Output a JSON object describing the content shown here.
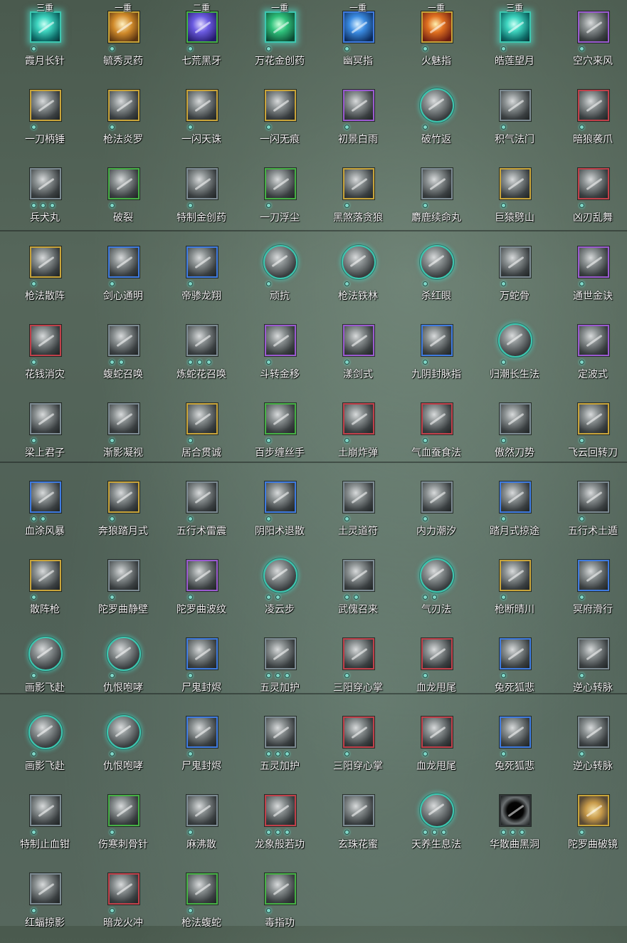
{
  "skills": [
    [
      {
        "name": "霞月长针",
        "rank": "三重",
        "frame": "glow",
        "color": "teal",
        "dots": 1
      },
      {
        "name": "毓秀灵药",
        "rank": "一重",
        "frame": "gold",
        "color": "orange",
        "dots": 1
      },
      {
        "name": "七荒黑牙",
        "rank": "二重",
        "frame": "green",
        "color": "purple",
        "dots": 1
      },
      {
        "name": "万花金创药",
        "rank": "一重",
        "frame": "glow",
        "color": "green",
        "dots": 1
      },
      {
        "name": "幽冥指",
        "rank": "一重",
        "frame": "blue",
        "color": "blue",
        "dots": 1
      },
      {
        "name": "火魅指",
        "rank": "一重",
        "frame": "gold",
        "color": "fire",
        "dots": 1
      },
      {
        "name": "皓莲望月",
        "rank": "三重",
        "frame": "glow",
        "color": "teal",
        "dots": 1
      },
      {
        "name": "空穴来风",
        "rank": "",
        "frame": "purple",
        "color": "",
        "dots": 1
      }
    ],
    [
      {
        "name": "一刀柄锤",
        "rank": "",
        "frame": "gold",
        "color": "",
        "dots": 1
      },
      {
        "name": "枪法炎罗",
        "rank": "",
        "frame": "gold",
        "color": "",
        "dots": 1
      },
      {
        "name": "一闪天诛",
        "rank": "",
        "frame": "gold",
        "color": "",
        "dots": 1
      },
      {
        "name": "一闪无痕",
        "rank": "",
        "frame": "gold",
        "color": "",
        "dots": 1
      },
      {
        "name": "初景白雨",
        "rank": "",
        "frame": "purple",
        "color": "",
        "dots": 1
      },
      {
        "name": "破竹返",
        "rank": "",
        "frame": "round",
        "color": "",
        "dots": 1
      },
      {
        "name": "积气法门",
        "rank": "",
        "frame": "silver",
        "color": "",
        "dots": 1
      },
      {
        "name": "暗狼袭爪",
        "rank": "",
        "frame": "red",
        "color": "",
        "dots": 1
      }
    ],
    [
      {
        "name": "兵犬丸",
        "rank": "",
        "frame": "silver",
        "color": "",
        "dots": 3
      },
      {
        "name": "破裂",
        "rank": "",
        "frame": "green",
        "color": "",
        "dots": 1
      },
      {
        "name": "特制金创药",
        "rank": "",
        "frame": "silver",
        "color": "",
        "dots": 1
      },
      {
        "name": "一刀浮尘",
        "rank": "",
        "frame": "green",
        "color": "",
        "dots": 1
      },
      {
        "name": "黑煞落贪狼",
        "rank": "",
        "frame": "gold",
        "color": "",
        "dots": 1
      },
      {
        "name": "麝鹿续命丸",
        "rank": "",
        "frame": "silver",
        "color": "",
        "dots": 1
      },
      {
        "name": "巨猿劈山",
        "rank": "",
        "frame": "gold",
        "color": "",
        "dots": 1
      },
      {
        "name": "凶刃乱舞",
        "rank": "",
        "frame": "red",
        "color": "",
        "dots": 1
      }
    ],
    [
      {
        "name": "枪法散阵",
        "rank": "",
        "frame": "gold",
        "color": "",
        "dots": 1
      },
      {
        "name": "剑心通明",
        "rank": "",
        "frame": "blue",
        "color": "",
        "dots": 1
      },
      {
        "name": "帝骖龙翔",
        "rank": "",
        "frame": "blue",
        "color": "",
        "dots": 1
      },
      {
        "name": "顽抗",
        "rank": "",
        "frame": "round",
        "color": "",
        "dots": 1
      },
      {
        "name": "枪法铁林",
        "rank": "",
        "frame": "round",
        "color": "",
        "dots": 1
      },
      {
        "name": "杀红眼",
        "rank": "",
        "frame": "round",
        "color": "",
        "dots": 1
      },
      {
        "name": "万蛇骨",
        "rank": "",
        "frame": "silver",
        "color": "",
        "dots": 1
      },
      {
        "name": "通世金诀",
        "rank": "",
        "frame": "purple",
        "color": "",
        "dots": 1
      }
    ],
    [
      {
        "name": "花钱消灾",
        "rank": "",
        "frame": "red",
        "color": "",
        "dots": 1
      },
      {
        "name": "蝮蛇召唤",
        "rank": "",
        "frame": "silver",
        "color": "",
        "dots": 2
      },
      {
        "name": "炼蛇花召唤",
        "rank": "",
        "frame": "silver",
        "color": "",
        "dots": 3
      },
      {
        "name": "斗转金移",
        "rank": "",
        "frame": "purple",
        "color": "",
        "dots": 1
      },
      {
        "name": "漾剑式",
        "rank": "",
        "frame": "purple",
        "color": "",
        "dots": 1
      },
      {
        "name": "九阴封脉指",
        "rank": "",
        "frame": "blue",
        "color": "",
        "dots": 1
      },
      {
        "name": "归潮长生法",
        "rank": "",
        "frame": "round",
        "color": "",
        "dots": 1
      },
      {
        "name": "定波式",
        "rank": "",
        "frame": "purple",
        "color": "",
        "dots": 1
      }
    ],
    [
      {
        "name": "梁上君子",
        "rank": "",
        "frame": "silver",
        "color": "",
        "dots": 1
      },
      {
        "name": "渐影凝视",
        "rank": "",
        "frame": "silver",
        "color": "",
        "dots": 1
      },
      {
        "name": "居合贯诚",
        "rank": "",
        "frame": "gold",
        "color": "",
        "dots": 1
      },
      {
        "name": "百步缠丝手",
        "rank": "",
        "frame": "green",
        "color": "",
        "dots": 1
      },
      {
        "name": "土崩炸弹",
        "rank": "",
        "frame": "red",
        "color": "",
        "dots": 1
      },
      {
        "name": "气血蚕食法",
        "rank": "",
        "frame": "red",
        "color": "",
        "dots": 1
      },
      {
        "name": "傲然刀势",
        "rank": "",
        "frame": "silver",
        "color": "",
        "dots": 1
      },
      {
        "name": "飞云回转刀",
        "rank": "",
        "frame": "gold",
        "color": "",
        "dots": 1
      }
    ],
    [
      {
        "name": "血涂风暴",
        "rank": "",
        "frame": "blue",
        "color": "",
        "dots": 2
      },
      {
        "name": "奔狼踏月式",
        "rank": "",
        "frame": "gold",
        "color": "",
        "dots": 1
      },
      {
        "name": "五行术雷震",
        "rank": "",
        "frame": "silver",
        "color": "",
        "dots": 1
      },
      {
        "name": "阴阳术退散",
        "rank": "",
        "frame": "blue",
        "color": "",
        "dots": 1
      },
      {
        "name": "土灵道符",
        "rank": "",
        "frame": "silver",
        "color": "",
        "dots": 1
      },
      {
        "name": "内力潮汐",
        "rank": "",
        "frame": "silver",
        "color": "",
        "dots": 1
      },
      {
        "name": "踏月式掠途",
        "rank": "",
        "frame": "blue",
        "color": "",
        "dots": 1
      },
      {
        "name": "五行术土遁",
        "rank": "",
        "frame": "silver",
        "color": "",
        "dots": 1
      }
    ],
    [
      {
        "name": "散阵枪",
        "rank": "",
        "frame": "gold",
        "color": "",
        "dots": 1
      },
      {
        "name": "陀罗曲静壁",
        "rank": "",
        "frame": "silver",
        "color": "",
        "dots": 1
      },
      {
        "name": "陀罗曲波纹",
        "rank": "",
        "frame": "purple",
        "color": "",
        "dots": 1
      },
      {
        "name": "凌云步",
        "rank": "",
        "frame": "round",
        "color": "",
        "dots": 2
      },
      {
        "name": "武傀召来",
        "rank": "",
        "frame": "silver",
        "color": "",
        "dots": 2
      },
      {
        "name": "气刃法",
        "rank": "",
        "frame": "round",
        "color": "",
        "dots": 2
      },
      {
        "name": "枪断晴川",
        "rank": "",
        "frame": "gold",
        "color": "",
        "dots": 1
      },
      {
        "name": "冥府滑行",
        "rank": "",
        "frame": "blue",
        "color": "",
        "dots": 1
      }
    ],
    [
      {
        "name": "画影飞赴",
        "rank": "",
        "frame": "round",
        "color": "",
        "dots": 1
      },
      {
        "name": "仇恨咆哮",
        "rank": "",
        "frame": "round",
        "color": "",
        "dots": 1
      },
      {
        "name": "尸鬼封烬",
        "rank": "",
        "frame": "blue",
        "color": "",
        "dots": 1
      },
      {
        "name": "五灵加护",
        "rank": "",
        "frame": "silver",
        "color": "",
        "dots": 3
      },
      {
        "name": "三阳穿心掌",
        "rank": "",
        "frame": "red",
        "color": "",
        "dots": 1
      },
      {
        "name": "血龙甩尾",
        "rank": "",
        "frame": "red",
        "color": "",
        "dots": 1
      },
      {
        "name": "兔死狐悲",
        "rank": "",
        "frame": "blue",
        "color": "",
        "dots": 1
      },
      {
        "name": "逆心转脉",
        "rank": "",
        "frame": "silver",
        "color": "",
        "dots": 1
      }
    ],
    [
      {
        "name": "画影飞赴",
        "rank": "",
        "frame": "round",
        "color": "",
        "dots": 1
      },
      {
        "name": "仇恨咆哮",
        "rank": "",
        "frame": "round",
        "color": "",
        "dots": 1
      },
      {
        "name": "尸鬼封烬",
        "rank": "",
        "frame": "blue",
        "color": "",
        "dots": 1
      },
      {
        "name": "五灵加护",
        "rank": "",
        "frame": "silver",
        "color": "",
        "dots": 3
      },
      {
        "name": "三阳穿心掌",
        "rank": "",
        "frame": "red",
        "color": "",
        "dots": 1
      },
      {
        "name": "血龙甩尾",
        "rank": "",
        "frame": "red",
        "color": "",
        "dots": 1
      },
      {
        "name": "兔死狐悲",
        "rank": "",
        "frame": "blue",
        "color": "",
        "dots": 1
      },
      {
        "name": "逆心转脉",
        "rank": "",
        "frame": "silver",
        "color": "",
        "dots": 1
      }
    ],
    [
      {
        "name": "特制止血钳",
        "rank": "",
        "frame": "silver",
        "color": "",
        "dots": 1
      },
      {
        "name": "伤寒刺骨针",
        "rank": "",
        "frame": "green",
        "color": "",
        "dots": 1
      },
      {
        "name": "麻沸散",
        "rank": "",
        "frame": "silver",
        "color": "",
        "dots": 1
      },
      {
        "name": "龙象般若功",
        "rank": "",
        "frame": "red",
        "color": "",
        "dots": 3
      },
      {
        "name": "玄珠花蜜",
        "rank": "",
        "frame": "silver",
        "color": "",
        "dots": 1
      },
      {
        "name": "天养生息法",
        "rank": "",
        "frame": "round",
        "color": "",
        "dots": 3
      },
      {
        "name": "华散曲黑洞",
        "rank": "",
        "frame": "dark",
        "color": "",
        "dots": 3
      },
      {
        "name": "陀罗曲破镜",
        "rank": "",
        "frame": "amber",
        "color": "",
        "dots": 1
      }
    ],
    [
      {
        "name": "红蝠掠影",
        "rank": "",
        "frame": "silver",
        "color": "",
        "dots": 1
      },
      {
        "name": "暗龙火冲",
        "rank": "",
        "frame": "red",
        "color": "",
        "dots": 1
      },
      {
        "name": "枪法蝮蛇",
        "rank": "",
        "frame": "green",
        "color": "",
        "dots": 1
      },
      {
        "name": "毒指功",
        "rank": "",
        "frame": "green",
        "color": "",
        "dots": 1
      }
    ]
  ]
}
